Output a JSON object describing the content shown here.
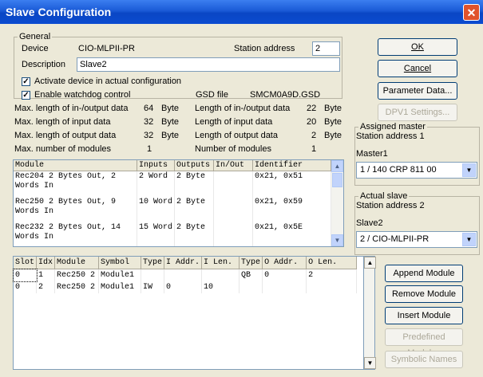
{
  "window": {
    "title": "Slave Configuration",
    "close_glyph": "✕"
  },
  "general": {
    "legend": "General",
    "device_label": "Device",
    "device_value": "CIO-MLPII-PR",
    "station_label": "Station address",
    "station_value": "2",
    "description_label": "Description",
    "description_value": "Slave2",
    "activate_label": "Activate device in actual configuration",
    "watchdog_label": "Enable watchdog control",
    "gsd_label": "GSD file",
    "gsd_value": "SMCM0A9D.GSD",
    "check_glyph": "✓"
  },
  "lengths": {
    "left": [
      {
        "label": "Max. length of in-/output data",
        "value": "64",
        "unit": "Byte"
      },
      {
        "label": "Max. length of input data",
        "value": "32",
        "unit": "Byte"
      },
      {
        "label": "Max. length of output data",
        "value": "32",
        "unit": "Byte"
      },
      {
        "label": "Max. number of modules",
        "value": "1",
        "unit": ""
      }
    ],
    "right": [
      {
        "label": "Length of in-/output data",
        "value": "22",
        "unit": "Byte"
      },
      {
        "label": "Length of input data",
        "value": "20",
        "unit": "Byte"
      },
      {
        "label": "Length of output data",
        "value": "2",
        "unit": "Byte"
      },
      {
        "label": "Number of modules",
        "value": "1",
        "unit": ""
      }
    ]
  },
  "buttons": {
    "ok": "OK",
    "cancel": "Cancel",
    "parameter": "Parameter Data...",
    "dpv1": "DPV1 Settings...",
    "append": "Append Module",
    "remove": "Remove Module",
    "insert": "Insert Module",
    "predefined": "Predefined Modules",
    "symbolic": "Symbolic Names"
  },
  "master": {
    "legend": "Assigned master",
    "station": "Station address 1",
    "name": "Master1",
    "selected": "1 / 140 CRP 811 00"
  },
  "slave": {
    "legend": "Actual slave",
    "station": "Station address 2",
    "name": "Slave2",
    "selected": "2 / CIO-MLPII-PR"
  },
  "module_table": {
    "headers": [
      "Module",
      "Inputs",
      "Outputs",
      "In/Out",
      "Identifier"
    ],
    "rows": [
      [
        "Rec204 2 Bytes Out, 2 Words In",
        "2 Word",
        "2 Byte",
        "",
        "0x21, 0x51"
      ],
      [
        "Rec250 2 Bytes Out, 9 Words In",
        "10 Word",
        "2 Byte",
        "",
        "0x21, 0x59"
      ],
      [
        "Rec232 2 Bytes Out, 14 Words In",
        "15 Word",
        "2 Byte",
        "",
        "0x21, 0x5E"
      ]
    ]
  },
  "slot_table": {
    "headers": [
      "Slot",
      "Idx",
      "Module",
      "Symbol",
      "Type",
      "I Addr.",
      "I Len.",
      "Type",
      "O Addr.",
      "O Len."
    ],
    "rows": [
      [
        "0",
        "1",
        "Rec250 2",
        "Module1",
        "",
        "",
        "",
        "QB",
        "0",
        "2"
      ],
      [
        "0",
        "2",
        "Rec250 2",
        "Module1",
        "IW",
        "0",
        "10",
        "",
        "",
        ""
      ]
    ]
  },
  "scroll": {
    "up": "▲",
    "down": "▼"
  }
}
